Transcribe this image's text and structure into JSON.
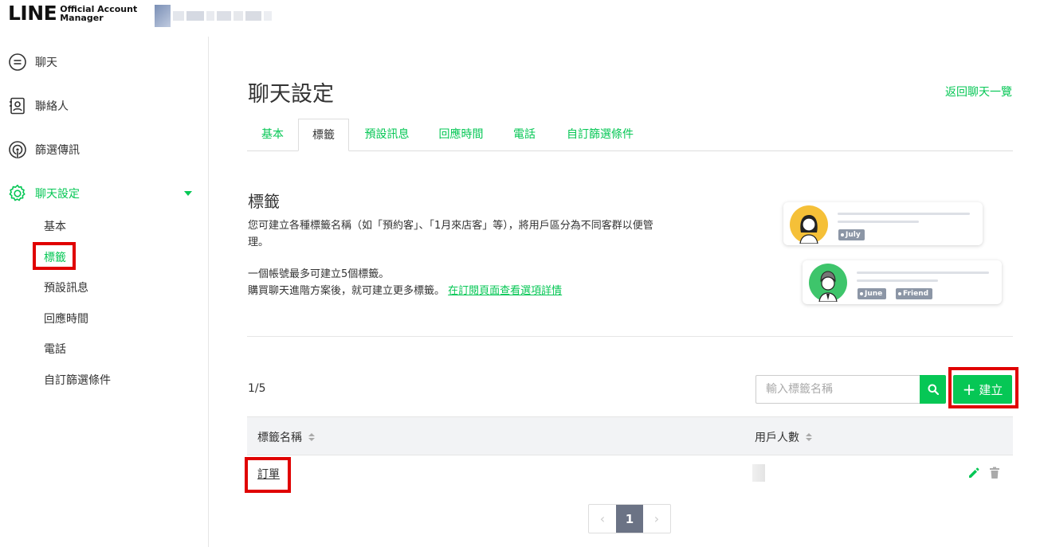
{
  "header": {
    "logo_main": "LINE",
    "logo_sub_line1": "Official Account",
    "logo_sub_line2": "Manager"
  },
  "sidebar": {
    "items": [
      {
        "label": "聊天",
        "icon": "chat-bubble-icon"
      },
      {
        "label": "聯絡人",
        "icon": "contacts-icon"
      },
      {
        "label": "篩選傳訊",
        "icon": "broadcast-icon"
      },
      {
        "label": "聊天設定",
        "icon": "gear-icon"
      }
    ],
    "sub_items": [
      "基本",
      "標籤",
      "預設訊息",
      "回應時間",
      "電話",
      "自訂篩選條件"
    ]
  },
  "page": {
    "title": "聊天設定",
    "back_link": "返回聊天一覽",
    "tabs": [
      "基本",
      "標籤",
      "預設訊息",
      "回應時間",
      "電話",
      "自訂篩選條件"
    ],
    "active_tab": "標籤"
  },
  "section": {
    "title": "標籤",
    "desc_line1": "您可建立各種標籤名稱（如「預約客」、「1月來店客」等），將用戶區分為不同客群以便管",
    "desc_line2": "理。",
    "limit_text": "一個帳號最多可建立5個標籤。",
    "upgrade_text": "購買聊天進階方案後，就可建立更多標籤。",
    "upgrade_link": "在訂閱頁面查看選項詳情"
  },
  "illustration": {
    "card1_tags": [
      "July"
    ],
    "card2_tags": [
      "June",
      "Friend"
    ]
  },
  "toolbar": {
    "count": "1/5",
    "search_placeholder": "輸入標籤名稱",
    "create_label": "建立",
    "create_plus": "+"
  },
  "table": {
    "headers": [
      "標籤名稱",
      "用戶人數"
    ],
    "rows": [
      {
        "name": "訂單"
      }
    ]
  },
  "pagination": {
    "prev": "‹",
    "current": "1",
    "next": "›"
  },
  "colors": {
    "accent": "#06c755",
    "highlight_box": "#e00000"
  }
}
